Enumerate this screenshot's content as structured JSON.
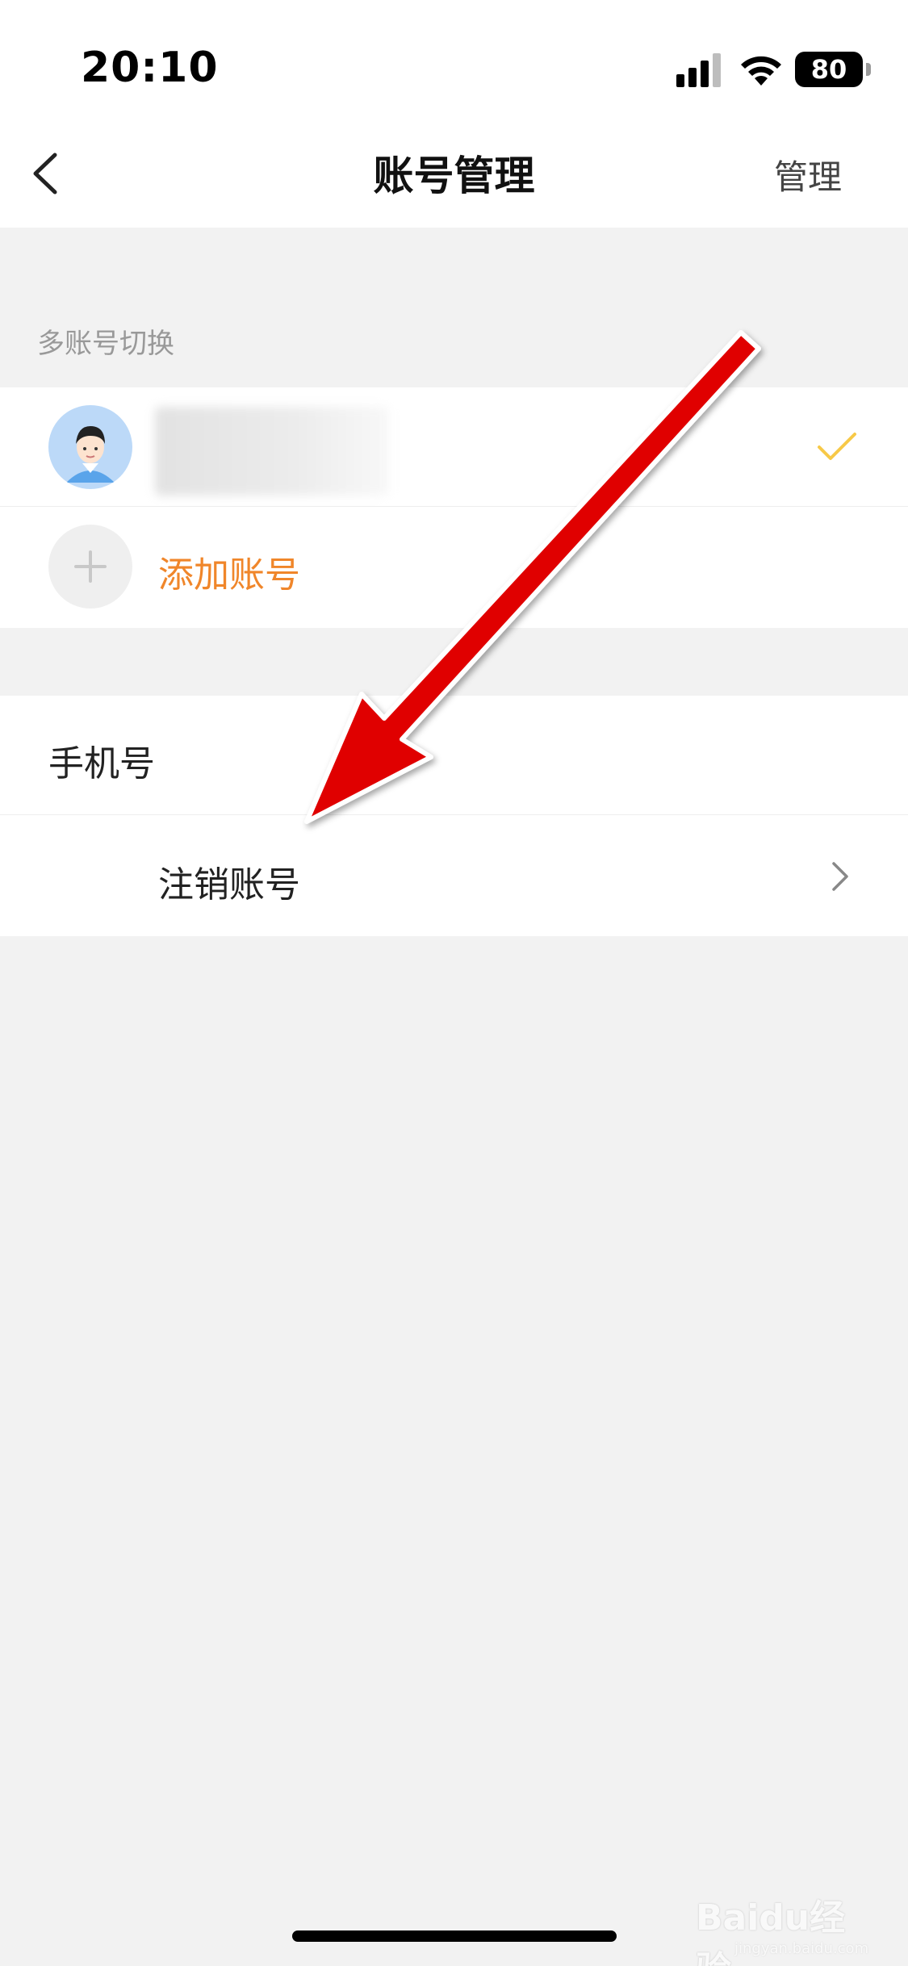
{
  "status_bar": {
    "time": "20:10",
    "battery_level": "80",
    "icons": [
      "signal-icon",
      "wifi-icon",
      "battery-icon"
    ]
  },
  "nav_bar": {
    "title": "账号管理",
    "right_action": "管理",
    "back_icon": "back-chevron-icon"
  },
  "accounts_section": {
    "label": "多账号切换",
    "current_account": {
      "name": "",
      "selected": true,
      "check_color": "#f7c948"
    },
    "add_account_label": "添加账号",
    "add_account_color": "#f0862a"
  },
  "settings_section": {
    "phone_label": "手机号",
    "cancel_account_label": "注销账号"
  },
  "annotation": {
    "arrow_color": "#e00000",
    "type": "arrow"
  },
  "watermark": {
    "text": "Baidu经验",
    "sub": "jingyan.baidu.com"
  },
  "colors": {
    "page_background": "#f2f2f2",
    "card_background": "#ffffff",
    "accent_orange": "#f0862a",
    "check_yellow": "#f7c948"
  }
}
